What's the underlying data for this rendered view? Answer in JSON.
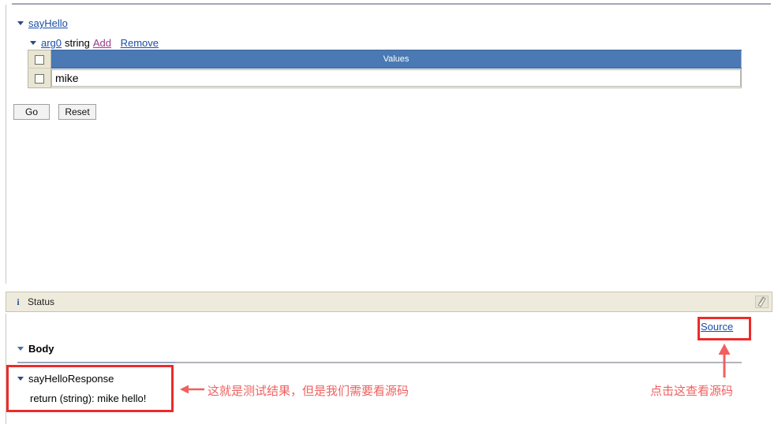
{
  "request": {
    "operation": {
      "label": "sayHello",
      "caret": "caret-down-icon"
    },
    "argument": {
      "name": "arg0",
      "type": "string",
      "add_label": "Add",
      "remove_label": "Remove"
    },
    "table": {
      "header": "Values",
      "rows": [
        {
          "checked": false,
          "value": "mike"
        }
      ]
    },
    "buttons": {
      "go": "Go",
      "reset": "Reset"
    }
  },
  "status": {
    "title": "Status",
    "info_icon": "i",
    "restore_icon": "restore-icon",
    "source_link": "Source",
    "body": {
      "heading": "Body",
      "response_node": "sayHelloResponse",
      "response_value": "return (string):  mike hello!"
    }
  },
  "annotations": {
    "center": "这就是测试结果，但是我们需要看源码",
    "right": "点击这查看源码",
    "color": "#f0605f"
  },
  "colors": {
    "table_header_blue": "#4a79b4",
    "link_blue": "#1a4ea8",
    "link_visited": "#9b3a8c",
    "status_bg": "#eeebdc",
    "annotation_red": "#ec2b2b"
  }
}
